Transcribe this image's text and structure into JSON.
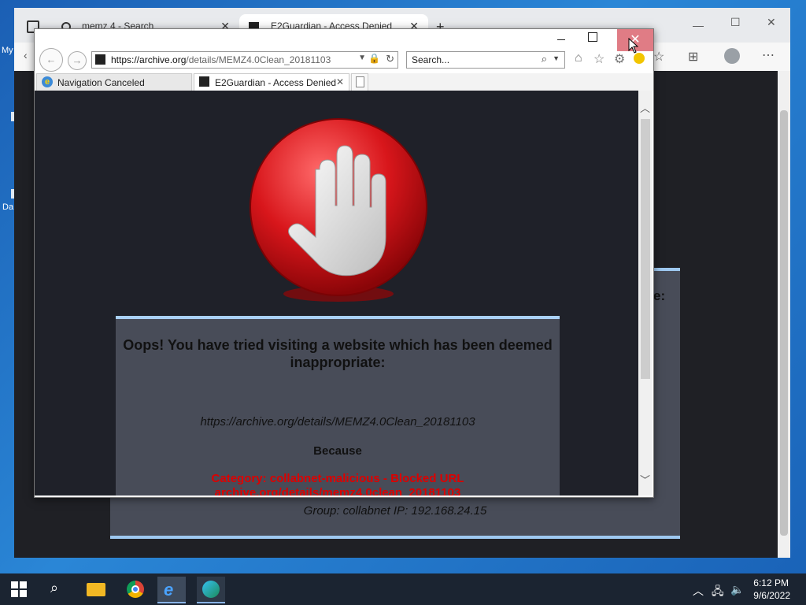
{
  "desktop": {
    "labels": [
      "My",
      "Da"
    ]
  },
  "edge": {
    "tabs": [
      {
        "label": "memz 4 - Search"
      },
      {
        "label": "E2Guardian - Access Denied"
      }
    ],
    "new_tab": "+",
    "background_message": {
      "colon_fragment": "e:",
      "group_line": "Group: collabnet    IP: 192.168.24.15"
    }
  },
  "ie": {
    "address": {
      "url_prefix": "https://archive.org",
      "url_rest": "/details/MEMZ4.0Clean_20181103"
    },
    "search": {
      "placeholder": "Search..."
    },
    "tabs": [
      {
        "label": "Navigation Canceled"
      },
      {
        "label": "E2Guardian - Access Denied"
      }
    ],
    "message": {
      "title": "Oops! You have tried visiting a website which has been deemed inappropriate:",
      "url": "https://archive.org/details/MEMZ4.0Clean_20181103",
      "because": "Because",
      "reason_line1": "Category: collabnet-malicious - Blocked URL",
      "reason_line2": "archive.org/details/memz4.0clean_20181103"
    }
  },
  "taskbar": {
    "time": "6:12 PM",
    "date": "9/6/2022"
  },
  "colors": {
    "stop_red": "#d8161b",
    "panel": "#484c58",
    "accent_border": "#a9d0f5",
    "reason_red": "#dd0000"
  }
}
